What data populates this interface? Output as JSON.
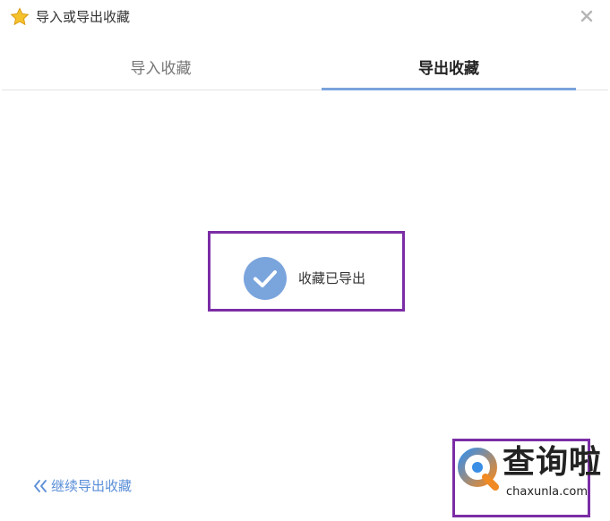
{
  "window": {
    "title": "导入或导出收藏",
    "icons": {
      "title_icon": "star-icon",
      "close": "close-icon"
    }
  },
  "tabs": [
    {
      "label": "导入收藏",
      "active": false
    },
    {
      "label": "导出收藏",
      "active": true
    }
  ],
  "status": {
    "message": "收藏已导出",
    "icon": "check-circle-icon"
  },
  "actions": {
    "continue_export": "继续导出收藏",
    "continue_icon": "double-chevron-left-icon"
  },
  "watermark": {
    "brand": "查询啦",
    "url": "chaxunla.com"
  },
  "colors": {
    "accent": "#7aa4dc",
    "link": "#5a8ed8",
    "check_circle": "#7aa4dc",
    "highlight": "#7b2da6",
    "star": "#f5c22b"
  }
}
